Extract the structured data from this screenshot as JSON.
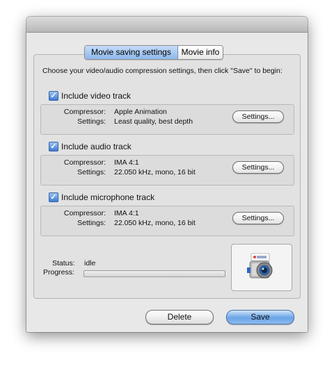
{
  "tabs": [
    {
      "label": "Movie saving settings",
      "selected": true
    },
    {
      "label": "Movie info",
      "selected": false
    }
  ],
  "intro": "Choose your video/audio compression settings, then click \"Save\" to begin:",
  "video": {
    "label": "Include video track",
    "checked": true,
    "compressor_label": "Compressor:",
    "compressor": "Apple Animation",
    "settings_label": "Settings:",
    "settings": "Least quality, best depth",
    "button": "Settings..."
  },
  "audio": {
    "label": "Include audio track",
    "checked": true,
    "compressor_label": "Compressor:",
    "compressor": "IMA 4:1",
    "settings_label": "Settings:",
    "settings": "22.050 kHz, mono, 16 bit",
    "button": "Settings..."
  },
  "microphone": {
    "label": "Include microphone track",
    "checked": true,
    "compressor_label": "Compressor:",
    "compressor": "IMA 4:1",
    "settings_label": "Settings:",
    "settings": "22.050 kHz, mono, 16 bit",
    "button": "Settings..."
  },
  "status": {
    "label": "Status:",
    "value": "idle",
    "progress_label": "Progress:",
    "progress": 0
  },
  "buttons": {
    "delete": "Delete",
    "save": "Save"
  },
  "colors": {
    "accent": "#7fb0ea",
    "window": "#e8e8e8"
  },
  "icons": {
    "app": "camera-icon",
    "check": "checkmark-icon"
  }
}
